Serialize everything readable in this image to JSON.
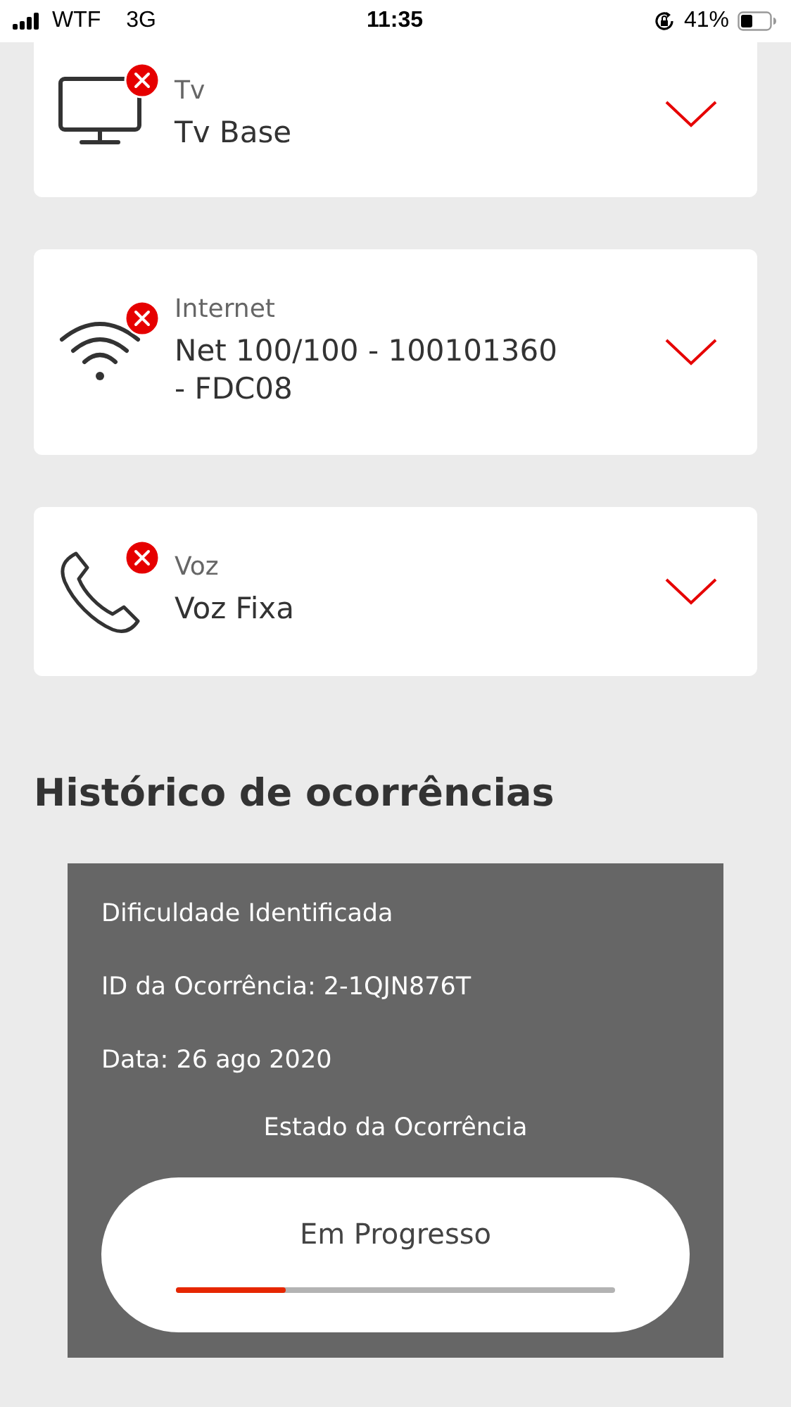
{
  "status_bar": {
    "carrier": "WTF",
    "network": "3G",
    "time": "11:35",
    "battery": "41%"
  },
  "services": [
    {
      "kind": "tv",
      "label": "Tv",
      "value": "Tv Base",
      "error": true,
      "expanded": false
    },
    {
      "kind": "internet",
      "label": "Internet",
      "value": "Net 100/100 - 100101360 - FDC08",
      "error": true,
      "expanded": false
    },
    {
      "kind": "voice",
      "label": "Voz",
      "value": "Voz Fixa",
      "error": true,
      "expanded": false
    }
  ],
  "history": {
    "title": "Histórico de ocorrências",
    "lines": [
      "Dificuldade Identificada",
      "ID da Ocorrência: 2-1QJN876T",
      "Data: 26 ago 2020"
    ],
    "state_label": "Estado da Ocorrência",
    "state": "Em Progresso",
    "level": 0.25
  }
}
